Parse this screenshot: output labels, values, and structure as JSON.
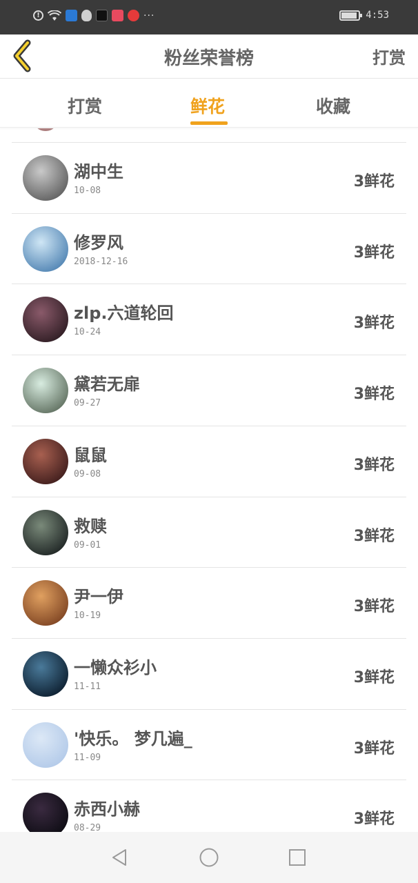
{
  "status_bar": {
    "time": "4:53",
    "icons": [
      "alert-icon",
      "wifi-icon",
      "shield-icon",
      "qq-icon",
      "tiktok-icon",
      "calendar-icon",
      "app-red-icon"
    ],
    "more": "···"
  },
  "header": {
    "title": "粉丝荣誉榜",
    "action_label": "打赏"
  },
  "tabs": [
    {
      "label": "打赏",
      "active": false
    },
    {
      "label": "鲜花",
      "active": true
    },
    {
      "label": "收藏",
      "active": false
    }
  ],
  "colors": {
    "accent": "#f0a21d",
    "text": "#555555",
    "status_bar": "#3a3a3a"
  },
  "fans": [
    {
      "name": "湖中生",
      "date": "10-08",
      "gift": "3鲜花",
      "avatar_colors": [
        "#c9c9c9",
        "#5a5a5a"
      ]
    },
    {
      "name": "修罗风",
      "date": "2018-12-16",
      "gift": "3鲜花",
      "avatar_colors": [
        "#cfe6f5",
        "#4a7fb0"
      ]
    },
    {
      "name": "zlp.六道轮回",
      "date": "10-24",
      "gift": "3鲜花",
      "avatar_colors": [
        "#8a5a6a",
        "#2a1a20"
      ]
    },
    {
      "name": "黛若无扉",
      "date": "09-27",
      "gift": "3鲜花",
      "avatar_colors": [
        "#d8ece0",
        "#5a6a5a"
      ]
    },
    {
      "name": "鼠鼠",
      "date": "09-08",
      "gift": "3鲜花",
      "avatar_colors": [
        "#a86050",
        "#3a1a1a"
      ]
    },
    {
      "name": "救赎",
      "date": "09-01",
      "gift": "3鲜花",
      "avatar_colors": [
        "#7a8a7a",
        "#1a2020"
      ]
    },
    {
      "name": "尹一伊",
      "date": "10-19",
      "gift": "3鲜花",
      "avatar_colors": [
        "#e0a060",
        "#7a4020"
      ]
    },
    {
      "name": "一懒众衫小",
      "date": "11-11",
      "gift": "3鲜花",
      "avatar_colors": [
        "#4a7a9a",
        "#0a1a2a"
      ]
    },
    {
      "name": "'快乐。 梦几遍_",
      "date": "11-09",
      "gift": "3鲜花",
      "avatar_colors": [
        "#dce8f6",
        "#b0c8e8"
      ]
    },
    {
      "name": "赤西小赫",
      "date": "08-29",
      "gift": "3鲜花",
      "avatar_colors": [
        "#3a2a40",
        "#0a0a10"
      ]
    }
  ]
}
